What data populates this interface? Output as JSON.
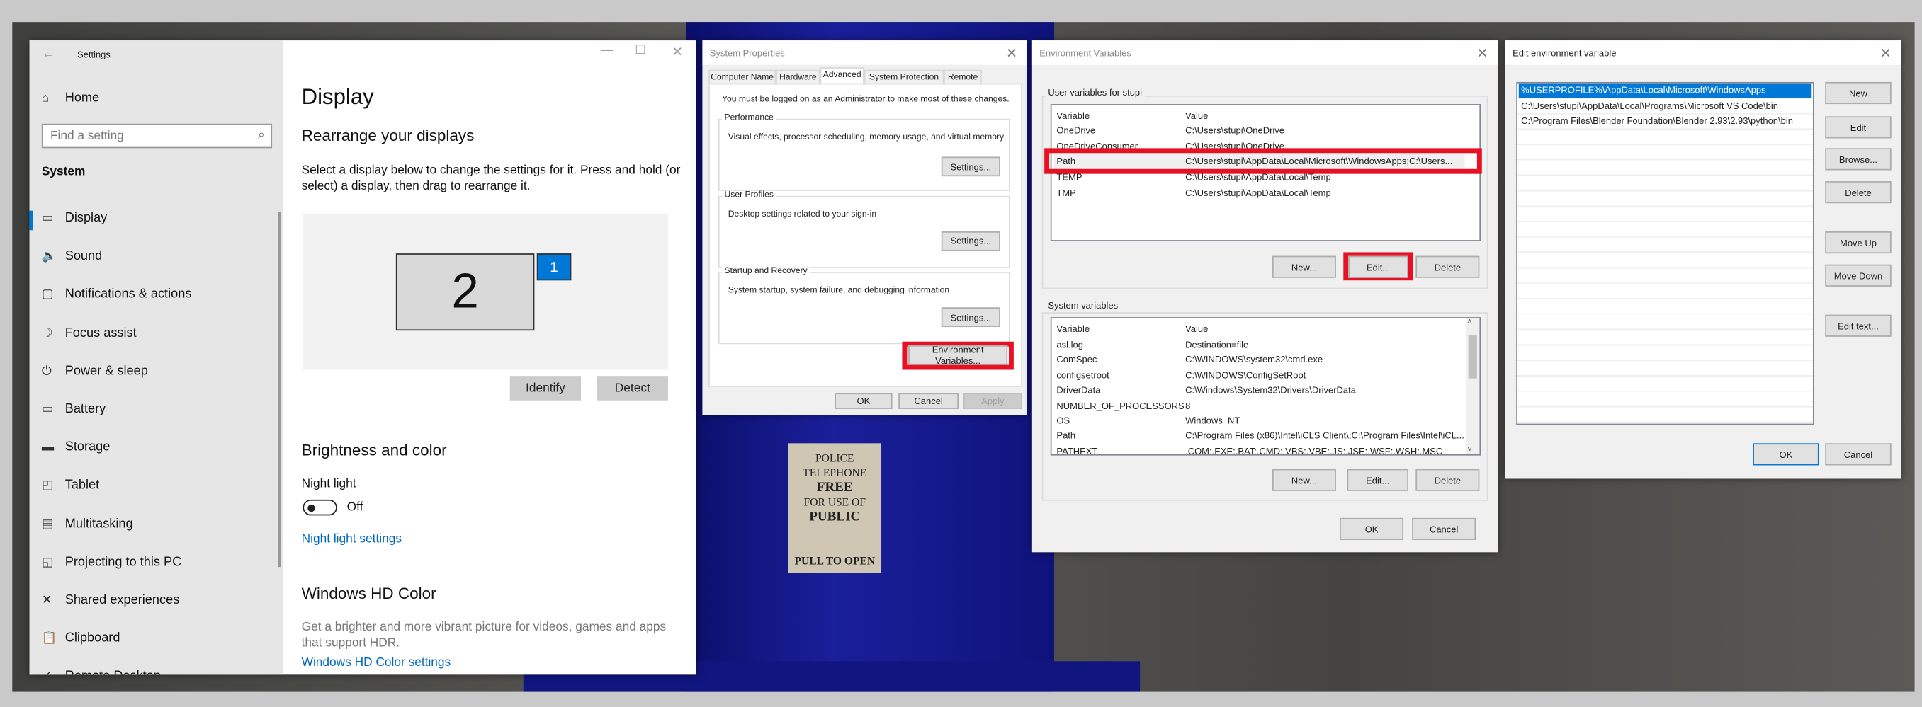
{
  "settings": {
    "title": "Settings",
    "home": "Home",
    "search_placeholder": "Find a setting",
    "section": "System",
    "nav": [
      {
        "label": "Display",
        "icon": "monitor-icon",
        "glyph": "▭"
      },
      {
        "label": "Sound",
        "icon": "speaker-icon",
        "glyph": "🔈"
      },
      {
        "label": "Notifications & actions",
        "icon": "notification-icon",
        "glyph": "▢"
      },
      {
        "label": "Focus assist",
        "icon": "moon-icon",
        "glyph": "☽"
      },
      {
        "label": "Power & sleep",
        "icon": "power-icon",
        "glyph": "⏻"
      },
      {
        "label": "Battery",
        "icon": "battery-icon",
        "glyph": "▭"
      },
      {
        "label": "Storage",
        "icon": "storage-icon",
        "glyph": "▬"
      },
      {
        "label": "Tablet",
        "icon": "tablet-icon",
        "glyph": "◰"
      },
      {
        "label": "Multitasking",
        "icon": "multitasking-icon",
        "glyph": "▤"
      },
      {
        "label": "Projecting to this PC",
        "icon": "projecting-icon",
        "glyph": "◱"
      },
      {
        "label": "Shared experiences",
        "icon": "shared-icon",
        "glyph": "✕"
      },
      {
        "label": "Clipboard",
        "icon": "clipboard-icon",
        "glyph": "📋"
      },
      {
        "label": "Remote Desktop",
        "icon": "remote-desktop-icon",
        "glyph": "✓"
      }
    ],
    "page_title": "Display",
    "rearrange_heading": "Rearrange your displays",
    "rearrange_desc_1": "Select a display below to change the settings for it. Press and hold (or",
    "rearrange_desc_2": "select) a display, then drag to rearrange it.",
    "monitor_2": "2",
    "monitor_1": "1",
    "identify": "Identify",
    "detect": "Detect",
    "brightness_heading": "Brightness and color",
    "night_light": "Night light",
    "night_light_state": "Off",
    "night_light_on": false,
    "night_light_link": "Night light settings",
    "hdr_heading": "Windows HD Color",
    "hdr_desc_1": "Get a brighter and more vibrant picture for videos, games and apps",
    "hdr_desc_2": "that support HDR.",
    "hdr_link": "Windows HD Color settings"
  },
  "sysprops": {
    "title": "System Properties",
    "tabs": [
      "Computer Name",
      "Hardware",
      "Advanced",
      "System Protection",
      "Remote"
    ],
    "active_tab": "Advanced",
    "admin_note": "You must be logged on as an Administrator to make most of these changes.",
    "groups": [
      {
        "label": "Performance",
        "desc": "Visual effects, processor scheduling, memory usage, and virtual memory",
        "button": "Settings..."
      },
      {
        "label": "User Profiles",
        "desc": "Desktop settings related to your sign-in",
        "button": "Settings..."
      },
      {
        "label": "Startup and Recovery",
        "desc": "System startup, system failure, and debugging information",
        "button": "Settings..."
      }
    ],
    "env_button": "Environment Variables...",
    "ok": "OK",
    "cancel": "Cancel",
    "apply": "Apply"
  },
  "envvars": {
    "title": "Environment Variables",
    "user_label": "User variables for stupi",
    "col_variable": "Variable",
    "col_value": "Value",
    "user_rows": [
      [
        "OneDrive",
        "C:\\Users\\stupi\\OneDrive"
      ],
      [
        "OneDriveConsumer",
        "C:\\Users\\stupi\\OneDrive"
      ],
      [
        "Path",
        "C:\\Users\\stupi\\AppData\\Local\\Microsoft\\WindowsApps;C:\\Users..."
      ],
      [
        "TEMP",
        "C:\\Users\\stupi\\AppData\\Local\\Temp"
      ],
      [
        "TMP",
        "C:\\Users\\stupi\\AppData\\Local\\Temp"
      ]
    ],
    "user_selected": "Path",
    "system_label": "System variables",
    "system_rows": [
      [
        "asl.log",
        "Destination=file"
      ],
      [
        "ComSpec",
        "C:\\WINDOWS\\system32\\cmd.exe"
      ],
      [
        "configsetroot",
        "C:\\WINDOWS\\ConfigSetRoot"
      ],
      [
        "DriverData",
        "C:\\Windows\\System32\\Drivers\\DriverData"
      ],
      [
        "NUMBER_OF_PROCESSORS",
        "8"
      ],
      [
        "OS",
        "Windows_NT"
      ],
      [
        "Path",
        "C:\\Program Files (x86)\\Intel\\iCLS Client\\;C:\\Program Files\\Intel\\iCL..."
      ],
      [
        "PATHEXT",
        ".COM;.EXE;.BAT;.CMD;.VBS;.VBE;.JS;.JSE;.WSF;.WSH;.MSC"
      ]
    ],
    "new": "New...",
    "edit": "Edit...",
    "delete": "Delete",
    "ok": "OK",
    "cancel": "Cancel"
  },
  "editenv": {
    "title": "Edit environment variable",
    "entries": [
      "%USERPROFILE%\\AppData\\Local\\Microsoft\\WindowsApps",
      "C:\\Users\\stupi\\AppData\\Local\\Programs\\Microsoft VS Code\\bin",
      "C:\\Program Files\\Blender Foundation\\Blender 2.93\\2.93\\python\\bin"
    ],
    "selected_index": 0,
    "buttons": [
      "New",
      "Edit",
      "Browse...",
      "Delete",
      "Move Up",
      "Move Down",
      "Edit text..."
    ],
    "ok": "OK",
    "cancel": "Cancel"
  },
  "colors": {
    "accent": "#0078d7",
    "highlight": "#e81123",
    "link": "#0067c0"
  }
}
